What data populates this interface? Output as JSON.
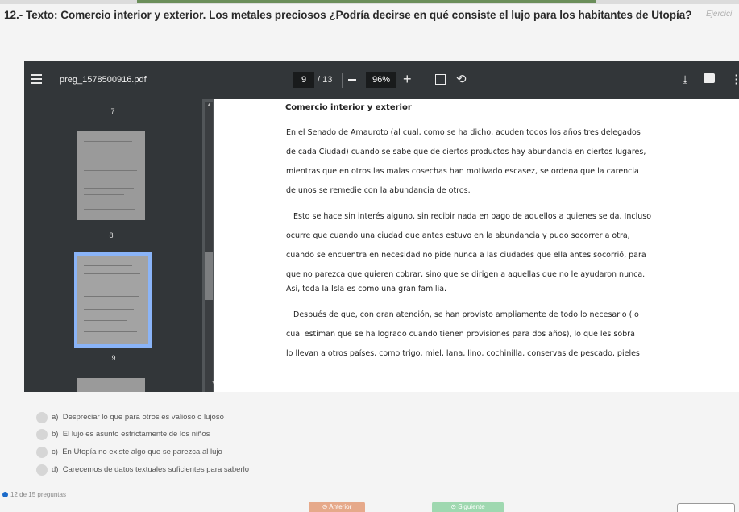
{
  "question": {
    "text": "12.- Texto: Comercio interior y exterior. Los metales preciosos ¿Podría decirse en qué consiste el lujo para los habitantes de Utopía?",
    "tag": "Ejercici"
  },
  "pdf": {
    "filename": "preg_1578500916.pdf",
    "current_page": "9",
    "page_total": "/ 13",
    "zoom": "96%",
    "thumbnails": [
      "7",
      "8",
      "9"
    ],
    "heading": "Comercio interior y exterior",
    "lines": [
      "En el Senado de Amauroto (al cual, como se ha dicho, acuden todos los años tres delegados",
      "de cada Ciudad) cuando se sabe que de ciertos productos hay abundancia en ciertos lugares,",
      "mientras que en otros las malas cosechas han motivado escasez, se ordena que la carencia",
      "de unos se remedie con la abundancia de otros.",
      "Esto se hace sin interés alguno, sin recibir nada en pago de aquellos a quienes se da. Incluso",
      "ocurre que cuando una ciudad que antes estuvo en la abundancia y pudo socorrer a otra,",
      "cuando se encuentra en necesidad no pide nunca a las ciudades que ella antes socorrió, para",
      "que no parezca que quieren cobrar, sino que se dirigen a aquellas que no le ayudaron nunca.",
      "Así, toda la Isla es como una gran familia.",
      "Después de que, con gran atención, se han provisto ampliamente de todo lo necesario (lo",
      "cual estiman que se ha logrado cuando tienen provisiones para dos años), lo que les sobra",
      "lo llevan a otros países, como trigo, miel, lana, lino, cochinilla, conservas de pescado, pieles"
    ]
  },
  "options": [
    {
      "letter": "a)",
      "text": "Despreciar lo que para otros es valioso o lujoso"
    },
    {
      "letter": "b)",
      "text": "El lujo es asunto estrictamente de los niños"
    },
    {
      "letter": "c)",
      "text": "En Utopía no existe algo que se parezca al lujo"
    },
    {
      "letter": "d)",
      "text": "Carecemos de datos textuales suficientes para saberlo"
    }
  ],
  "footer": {
    "count": "12 de 15 preguntas",
    "prev": "Anterior",
    "next": "Siguiente"
  },
  "colors": {
    "accent": "#1b6ac9",
    "prev_button": "#e6a98a",
    "next_button": "#9fd8b0",
    "viewer_toolbar": "#323639"
  }
}
